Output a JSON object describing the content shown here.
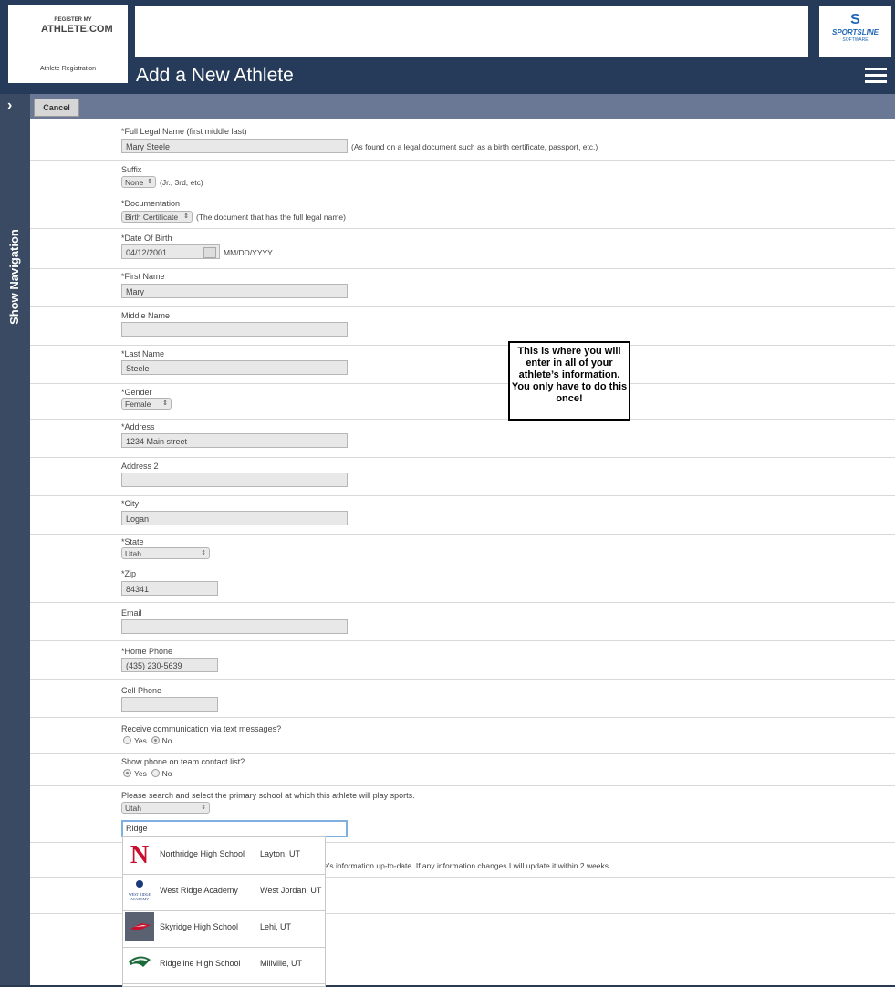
{
  "header": {
    "logo_line1": "REGISTER MY",
    "logo_line2": "ATHLETE.COM",
    "logo_caption": "Athlete Registration",
    "brand_name": "SPORTSLINE",
    "brand_sub": "SOFTWARE",
    "page_title": "Add a New Athlete"
  },
  "sidebar": {
    "toggle_label": "Show Navigation"
  },
  "toolbar": {
    "cancel_label": "Cancel"
  },
  "form": {
    "full_name": {
      "label": "*Full Legal Name (first middle last)",
      "value": "Mary Steele",
      "hint": "(As found on a legal document such as a birth certificate, passport, etc.)"
    },
    "suffix": {
      "label": "Suffix",
      "value": "None",
      "hint": "(Jr., 3rd, etc)"
    },
    "documentation": {
      "label": "*Documentation",
      "value": "Birth Certificate",
      "hint": "(The document that has the full legal name)"
    },
    "dob": {
      "label": "*Date Of Birth",
      "value": "04/12/2001",
      "hint": "MM/DD/YYYY"
    },
    "first_name": {
      "label": "*First Name",
      "value": "Mary"
    },
    "middle_name": {
      "label": "Middle Name",
      "value": ""
    },
    "last_name": {
      "label": "*Last Name",
      "value": "Steele"
    },
    "gender": {
      "label": "*Gender",
      "value": "Female"
    },
    "address": {
      "label": "*Address",
      "value": "1234 Main street"
    },
    "address2": {
      "label": "Address 2",
      "value": ""
    },
    "city": {
      "label": "*City",
      "value": "Logan"
    },
    "state": {
      "label": "*State",
      "value": "Utah"
    },
    "zip": {
      "label": "*Zip",
      "value": "84341"
    },
    "email": {
      "label": "Email",
      "value": ""
    },
    "home_phone": {
      "label": "*Home Phone",
      "value": "(435) 230-5639"
    },
    "cell_phone": {
      "label": "Cell Phone",
      "value": ""
    },
    "text_messages": {
      "label": "Receive communication via text messages?",
      "yes": "Yes",
      "no": "No"
    },
    "show_phone": {
      "label": "Show phone on team contact list?",
      "yes": "Yes",
      "no": "No"
    },
    "school": {
      "label": "Please search and select the primary school at which this athlete will play sports.",
      "state": "Utah",
      "search": "Ridge"
    },
    "agreement_text": "e's information up-to-date. If any information changes I will update it within 2 weeks."
  },
  "callout": "This is where you will enter in all of your athlete’s information. You only have to do this once!",
  "schools": [
    {
      "name": "Northridge High School",
      "location": "Layton, UT",
      "logo": "northridge-logo",
      "color": "#c8102e"
    },
    {
      "name": "West Ridge Academy",
      "location": "West Jordan, UT",
      "logo": "west-ridge-logo",
      "logo_text": "WEST RIDGE ACADEMY",
      "color": "#1a3a7a"
    },
    {
      "name": "Skyridge High School",
      "location": "Lehi, UT",
      "logo": "skyridge-logo",
      "color": "#c8102e"
    },
    {
      "name": "Ridgeline High School",
      "location": "Millville, UT",
      "logo": "ridgeline-logo",
      "color": "#1b6b3a"
    }
  ]
}
